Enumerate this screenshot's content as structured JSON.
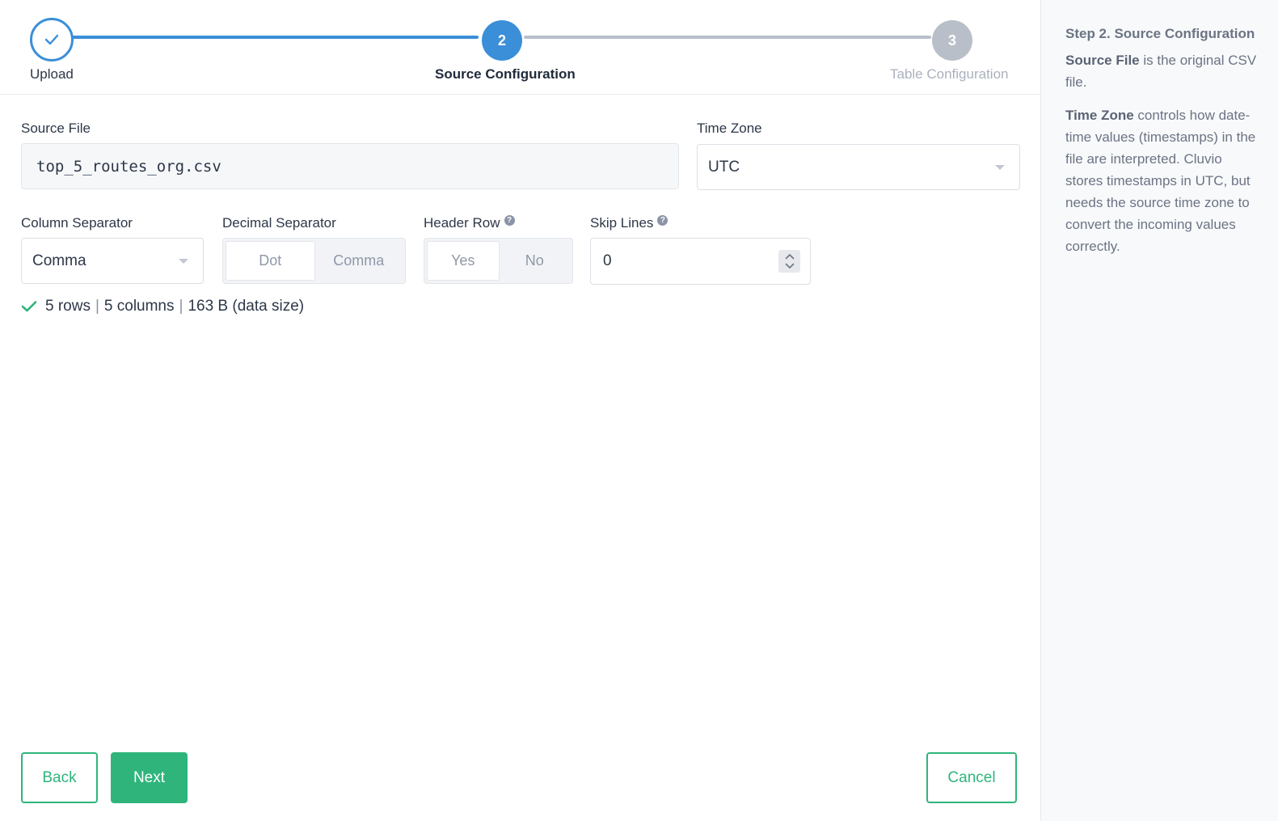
{
  "stepper": {
    "steps": [
      {
        "number": "1",
        "label": "Upload",
        "state": "done"
      },
      {
        "number": "2",
        "label": "Source Configuration",
        "state": "active"
      },
      {
        "number": "3",
        "label": "Table Configuration",
        "state": "todo"
      }
    ]
  },
  "form": {
    "source_file_label": "Source File",
    "source_file_value": "top_5_routes_org.csv",
    "time_zone_label": "Time Zone",
    "time_zone_value": "UTC",
    "column_separator_label": "Column Separator",
    "column_separator_value": "Comma",
    "decimal_separator_label": "Decimal Separator",
    "decimal_options": [
      "Dot",
      "Comma"
    ],
    "decimal_selected": "Dot",
    "header_row_label": "Header Row",
    "header_options": [
      "Yes",
      "No"
    ],
    "header_selected": "Yes",
    "skip_lines_label": "Skip Lines",
    "skip_lines_value": "0",
    "help_glyph": "?"
  },
  "status": {
    "rows": "5 rows",
    "columns": "5 columns",
    "size": "163 B (data size)",
    "separator": "|"
  },
  "buttons": {
    "back": "Back",
    "next": "Next",
    "cancel": "Cancel"
  },
  "sidebar": {
    "title": "Step 2. Source Configuration",
    "p1_term": "Source File",
    "p1_text": " is the original CSV file.",
    "p2_term": "Time Zone",
    "p2_text": " controls how date-time values (timestamps) in the file are interpreted. Cluvio stores timestamps in UTC, but needs the source time zone to convert the incoming values correctly."
  },
  "colors": {
    "primary_blue": "#3a8fd8",
    "accent_green": "#2fb57c",
    "inactive_gray": "#b9bfc9"
  }
}
